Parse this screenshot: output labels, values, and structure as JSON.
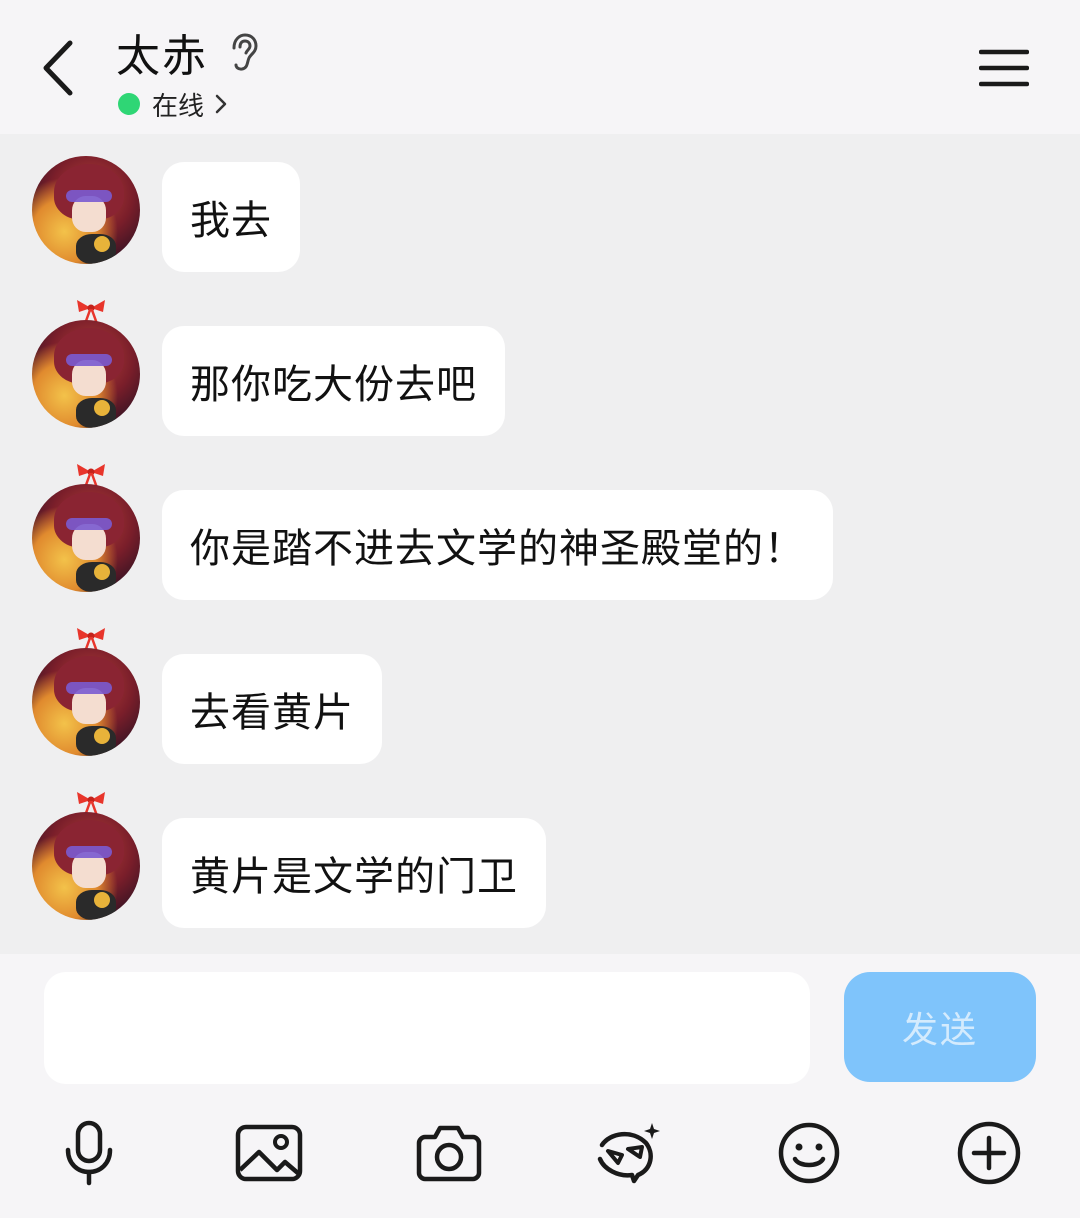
{
  "header": {
    "title": "太赤",
    "status_text": "在线",
    "status_color": "#2fd675",
    "icons": [
      "back-arrow-icon",
      "ear-icon",
      "chevron-right-icon",
      "menu-icon"
    ]
  },
  "messages": [
    {
      "sender": "太赤",
      "text": "我去",
      "has_bow": false
    },
    {
      "sender": "太赤",
      "text": "那你吃大份去吧",
      "has_bow": true
    },
    {
      "sender": "太赤",
      "text": "你是踏不进去文学的神圣殿堂的！",
      "has_bow": true
    },
    {
      "sender": "太赤",
      "text": "去看黄片",
      "has_bow": true
    },
    {
      "sender": "太赤",
      "text": "黄片是文学的门卫",
      "has_bow": true
    }
  ],
  "composer": {
    "value": "",
    "placeholder": "",
    "send_label": "发送",
    "send_color": "#7fc4fb"
  },
  "toolbar": {
    "items": [
      "microphone-icon",
      "image-icon",
      "camera-icon",
      "sticker-icon",
      "emoji-icon",
      "plus-icon"
    ]
  },
  "colors": {
    "background": "#efeff0",
    "bubble": "#ffffff",
    "header": "#f6f5f7"
  }
}
